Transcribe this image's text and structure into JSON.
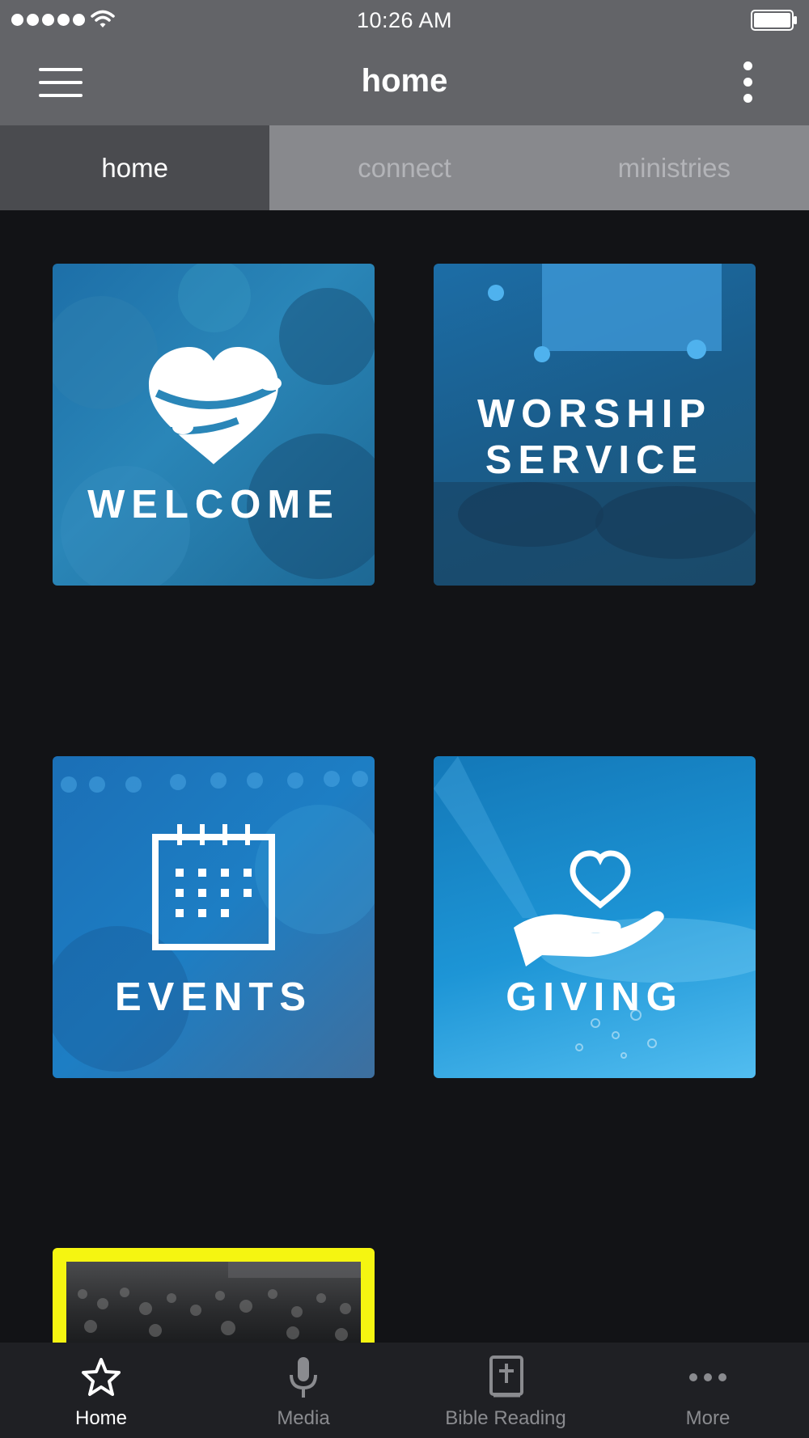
{
  "status_bar": {
    "time": "10:26 AM",
    "icons": [
      "signal-dots-icon",
      "wifi-icon",
      "battery-icon"
    ]
  },
  "header": {
    "title": "home",
    "menu_icon": "hamburger-menu-icon",
    "overflow_icon": "vertical-dots-icon"
  },
  "tabs": [
    {
      "label": "home",
      "active": true
    },
    {
      "label": "connect",
      "active": false
    },
    {
      "label": "ministries",
      "active": false
    }
  ],
  "tiles": {
    "welcome": {
      "label": "WELCOME",
      "icon": "heart-hug-icon"
    },
    "worship": {
      "line1": "WORSHIP",
      "line2": "SERVICE"
    },
    "events": {
      "label": "EVENTS",
      "icon": "calendar-icon"
    },
    "giving": {
      "label": "GIVING",
      "icon": "heart-in-hand-icon"
    }
  },
  "bottom_nav": [
    {
      "label": "Home",
      "icon": "star-icon",
      "active": true
    },
    {
      "label": "Media",
      "icon": "microphone-icon",
      "active": false
    },
    {
      "label": "Bible Reading",
      "icon": "bible-icon",
      "active": false
    },
    {
      "label": "More",
      "icon": "more-dots-icon",
      "active": false
    }
  ],
  "colors": {
    "header_bg": "#636468",
    "tab_active_bg": "#4a4b4f",
    "tab_inactive_bg": "#88898d",
    "page_bg": "#121316",
    "featured_border": "#f5f511",
    "bottom_bar_bg": "#1f2024"
  }
}
